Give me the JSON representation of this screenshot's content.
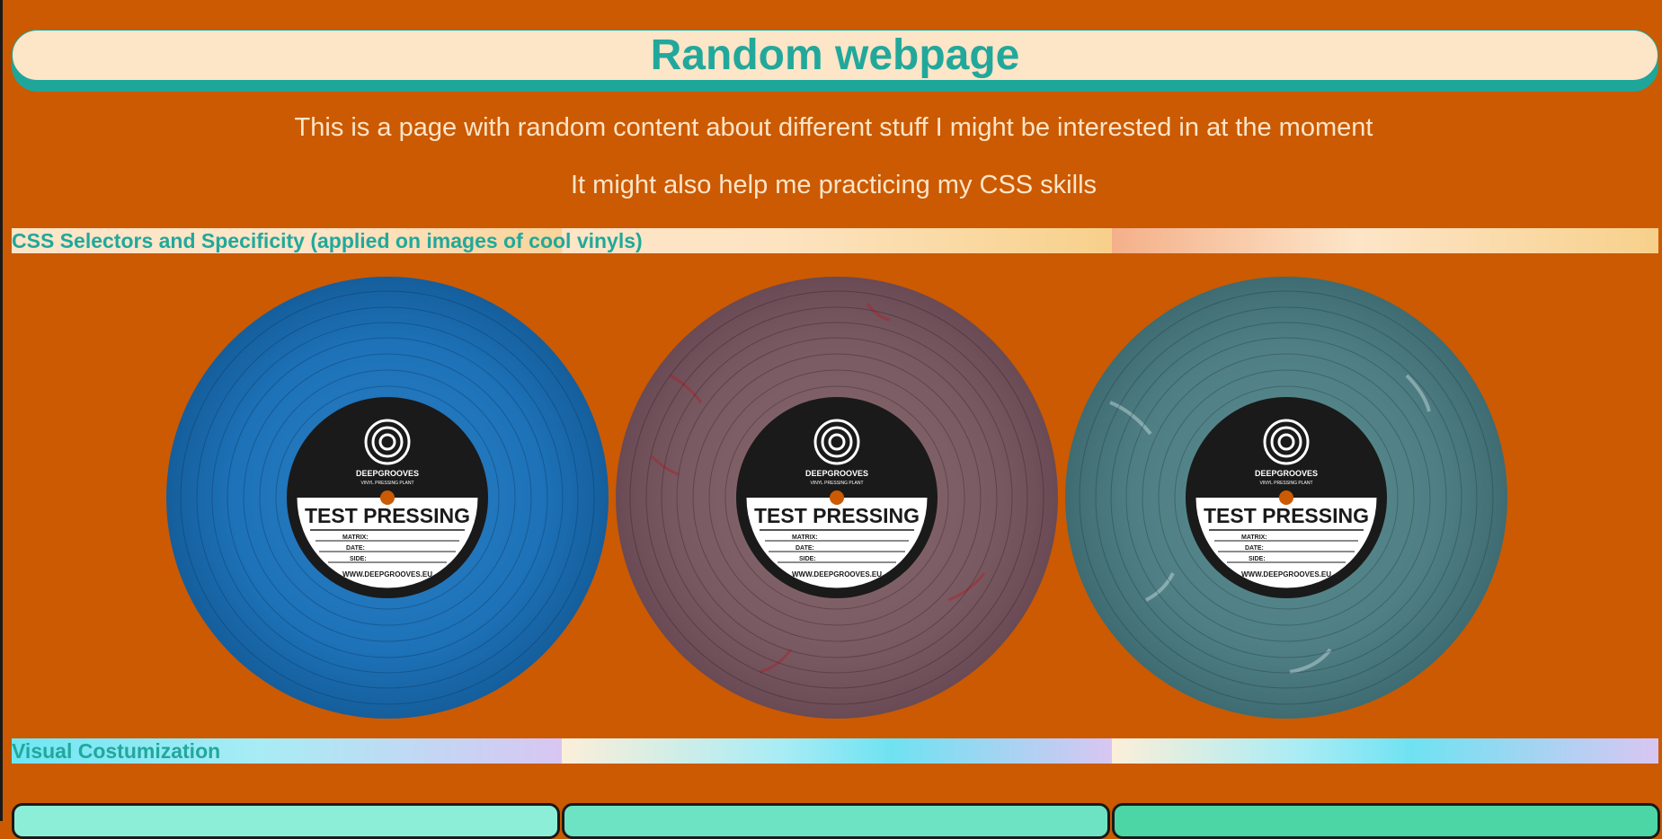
{
  "header": {
    "title": "Random webpage"
  },
  "intro": {
    "line1": "This is a page with random content about different stuff I might be interested in at the moment",
    "line2": "It might also help me practicing my CSS skills"
  },
  "sections": {
    "css_selectors": {
      "heading": "CSS Selectors and Specificity (applied on images of cool vinyls)"
    },
    "visual": {
      "heading": "Visual Costumization"
    }
  },
  "vinyls": [
    {
      "color": "#1a6fb0",
      "label_brand": "DEEPGROOVES",
      "label_sub": "VINYL PRESSING PLANT",
      "label_title": "TEST PRESSING",
      "field_matrix": "MATRIX:",
      "field_date": "DATE:",
      "field_side": "SIDE:",
      "url": "WWW.DEEPGROOVES.EU"
    },
    {
      "color": "#7a5a60",
      "label_brand": "DEEPGROOVES",
      "label_sub": "VINYL PRESSING PLANT",
      "label_title": "TEST PRESSING",
      "field_matrix": "MATRIX:",
      "field_date": "DATE:",
      "field_side": "SIDE:",
      "url": "WWW.DEEPGROOVES.EU"
    },
    {
      "color": "#4f7f84",
      "label_brand": "DEEPGROOVES",
      "label_sub": "VINYL PRESSING PLANT",
      "label_title": "TEST PRESSING",
      "field_matrix": "MATRIX:",
      "field_date": "DATE:",
      "field_side": "SIDE:",
      "url": "WWW.DEEPGROOVES.EU"
    }
  ],
  "colors": {
    "background": "#cb5a02",
    "accent": "#21a89b",
    "cream": "#fde5c8"
  }
}
